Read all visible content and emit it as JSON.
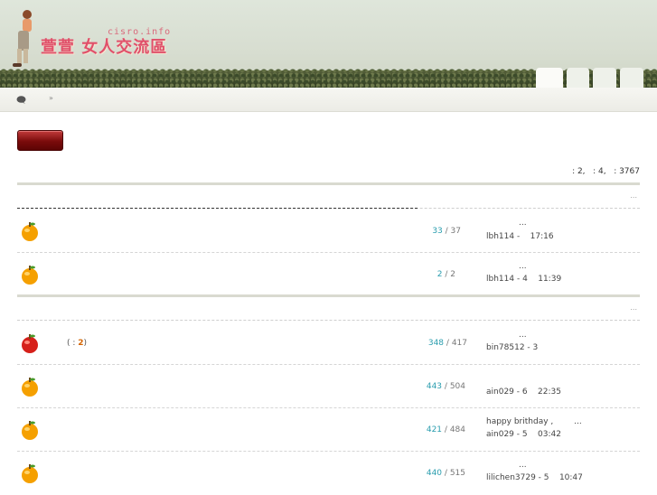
{
  "header": {
    "logo_text": "萱萱 女人交流區",
    "logo_domain": "cisro.info"
  },
  "nav": {
    "separator": "»"
  },
  "stats_text": ": 2,   : 4,   : 3767",
  "sections": [
    {
      "ellipsis": "...",
      "rows": [
        {
          "icon": "orange-fruit-icon",
          "topics": "33",
          "posts": "37",
          "last_title": "...",
          "last_meta": "lbh114 -    17:16"
        },
        {
          "icon": "orange-fruit-icon",
          "topics": "2",
          "posts": "2",
          "last_title": "...",
          "last_meta": "lbh114 - 4    11:39"
        }
      ]
    },
    {
      "ellipsis": "...",
      "rows": [
        {
          "icon": "red-apple-icon",
          "subnote_pre": "(  : ",
          "subnote_num": "2",
          "subnote_post": ")",
          "topics": "348",
          "posts": "417",
          "last_title": "...",
          "last_meta": "bin78512 - 3"
        },
        {
          "icon": "orange-fruit-icon",
          "topics": "443",
          "posts": "504",
          "last_title": "",
          "last_meta": "ain029 - 6    22:35"
        },
        {
          "icon": "orange-fruit-icon",
          "topics": "421",
          "posts": "484",
          "last_title": "happy brithday ,        ...",
          "last_meta": "ain029 - 5    03:42"
        },
        {
          "icon": "orange-fruit-icon",
          "topics": "440",
          "posts": "515",
          "last_title": "...",
          "last_meta": "lilichen3729 - 5    10:47"
        }
      ]
    }
  ],
  "colors": {
    "accent_teal": "#2a9dae",
    "button_red": "#7a0b0b",
    "highlight_orange": "#d46400"
  }
}
